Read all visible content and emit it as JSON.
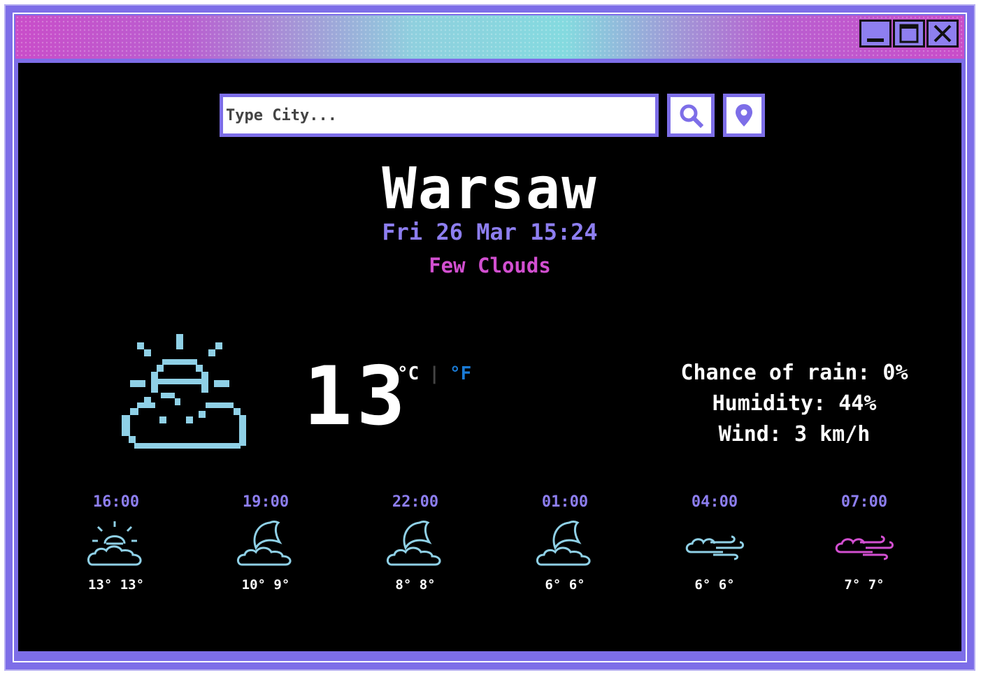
{
  "search": {
    "placeholder": "Type City..."
  },
  "location": {
    "city": "Warsaw",
    "datetime": "Fri 26 Mar 15:24",
    "description": "Few Clouds"
  },
  "current": {
    "temperature": "13",
    "unit_c": "°C",
    "unit_separator": "|",
    "unit_f": "°F",
    "chance_of_rain": "Chance of rain: 0%",
    "humidity": "Humidity: 44%",
    "wind": "Wind: 3 km/h",
    "icon": "sun-cloud-icon"
  },
  "forecast": [
    {
      "time": "16:00",
      "temps": "13° 13°",
      "icon": "sun-cloud-icon"
    },
    {
      "time": "19:00",
      "temps": "10° 9°",
      "icon": "moon-cloud-icon"
    },
    {
      "time": "22:00",
      "temps": "8° 8°",
      "icon": "moon-cloud-icon"
    },
    {
      "time": "01:00",
      "temps": "6° 6°",
      "icon": "moon-cloud-icon"
    },
    {
      "time": "04:00",
      "temps": "6° 6°",
      "icon": "wind-cloud-icon"
    },
    {
      "time": "07:00",
      "temps": "7° 7°",
      "icon": "wind-cloud-icon"
    }
  ],
  "colors": {
    "frame": "#7d6ee8",
    "accent_purple": "#8d7ef0",
    "accent_pink": "#d24fd0",
    "icon_cyan": "#8fd0e6",
    "icon_magenta": "#d24fd0",
    "unit_blue": "#1a7bd6"
  }
}
